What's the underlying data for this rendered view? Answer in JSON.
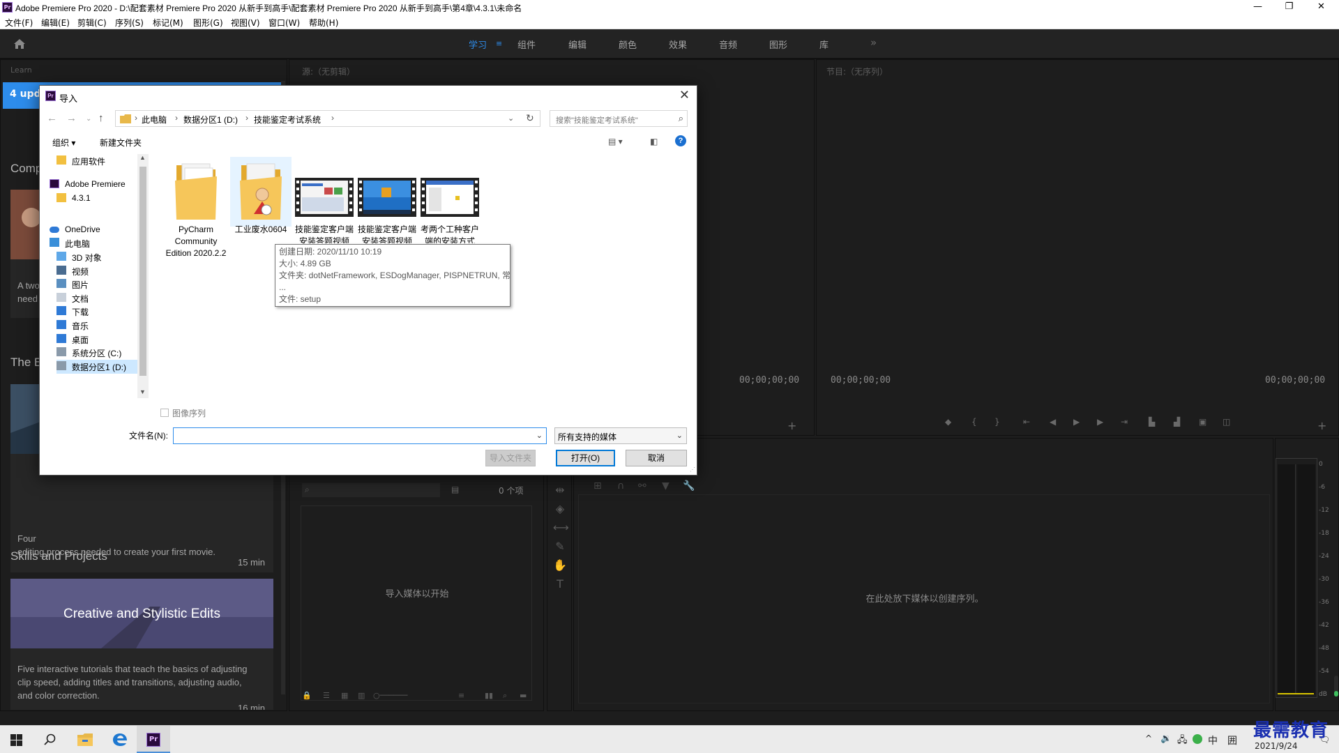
{
  "window": {
    "title": "Adobe Premiere Pro 2020 - D:\\配套素材 Premiere Pro 2020 从新手到高手\\配套素材 Premiere Pro 2020 从新手到高手\\第4章\\4.3.1\\未命名",
    "logo_text": "Pr"
  },
  "menu": [
    "文件(F)",
    "编辑(E)",
    "剪辑(C)",
    "序列(S)",
    "标记(M)",
    "图形(G)",
    "视图(V)",
    "窗口(W)",
    "帮助(H)"
  ],
  "workspaces": [
    "学习",
    "组件",
    "编辑",
    "颜色",
    "效果",
    "音频",
    "图形",
    "库"
  ],
  "workspace_active": "学习",
  "workspace_more": "»",
  "learn_panel": {
    "tab": "Learn",
    "updates_label": "4 upd",
    "section1": "Comp",
    "card1_desc": [
      "A two",
      "need"
    ],
    "section2": "The B",
    "card2_desc": [
      "Four",
      "editing process needed to create your first movie."
    ],
    "card2_duration": "15 min",
    "section3": "Skills and Projects",
    "card3_title": "Creative and Stylistic Edits",
    "card3_desc": [
      "Five interactive tutorials that teach the basics of adjusting",
      "clip speed, adding titles and transitions, adjusting audio,",
      "and color correction."
    ],
    "card3_duration": "16 min"
  },
  "source_panel": {
    "tab": "源:（无剪辑）",
    "timecode": "00;00;00;00"
  },
  "program_panel": {
    "tab": "节目:（无序列）",
    "timecode_left": "00;00;00;00",
    "timecode_right": "00;00;00;00"
  },
  "project_panel": {
    "count": "0 个项",
    "empty_text": "导入媒体以开始"
  },
  "timeline_panel": {
    "empty_text": "在此处放下媒体以创建序列。"
  },
  "audio_meter": {
    "ticks": [
      "0",
      "-6",
      "-12",
      "-18",
      "-24",
      "-30",
      "-36",
      "-42",
      "-48",
      "-54",
      "dB"
    ]
  },
  "dialog": {
    "title": "导入",
    "breadcrumb": [
      "此电脑",
      "数据分区1 (D:)",
      "技能鉴定考试系统"
    ],
    "search_placeholder": "搜索\"技能鉴定考试系统\"",
    "toolbar": {
      "organize": "组织 ▾",
      "new_folder": "新建文件夹"
    },
    "tree": [
      {
        "label": "应用软件",
        "icon": "folder-icon"
      },
      {
        "label": "Adobe Premiere",
        "icon": "premiere-icon"
      },
      {
        "label": "4.3.1",
        "icon": "folder-icon"
      },
      {
        "label": "OneDrive",
        "icon": "cloud-icon"
      },
      {
        "label": "此电脑",
        "icon": "computer-icon"
      },
      {
        "label": "3D 对象",
        "icon": "cube-icon"
      },
      {
        "label": "视频",
        "icon": "video-icon"
      },
      {
        "label": "图片",
        "icon": "picture-icon"
      },
      {
        "label": "文档",
        "icon": "document-icon"
      },
      {
        "label": "下载",
        "icon": "download-icon"
      },
      {
        "label": "音乐",
        "icon": "music-icon"
      },
      {
        "label": "桌面",
        "icon": "desktop-icon"
      },
      {
        "label": "系统分区 (C:)",
        "icon": "drive-icon"
      },
      {
        "label": "数据分区1 (D:)",
        "icon": "drive-icon"
      }
    ],
    "files": [
      {
        "label": "PyCharm Community Edition 2020.2.2",
        "kind": "folder"
      },
      {
        "label": "工业废水0604",
        "kind": "folder-user"
      },
      {
        "label": "技能鉴定客户端安装答题视频",
        "kind": "video"
      },
      {
        "label": "技能鉴定客户端安装答题视频",
        "kind": "video"
      },
      {
        "label": "考两个工种客户端的安装方式",
        "kind": "video"
      }
    ],
    "tooltip": [
      "创建日期: 2020/11/10 10:19",
      "大小: 4.89 GB",
      "文件夹: dotNetFramework, ESDogManager, PISPNETRUN, 常用插件,",
      "...",
      "文件: setup"
    ],
    "image_sequence_label": "图像序列",
    "filename_label": "文件名(N):",
    "filename_value": "",
    "filter_value": "所有支持的媒体",
    "buttons": {
      "import_folder": "导入文件夹",
      "open": "打开(O)",
      "cancel": "取消"
    }
  },
  "taskbar": {
    "tray": [
      "^",
      "🔊",
      "中",
      "囲"
    ],
    "date": "2021/9/24"
  },
  "watermark": "最需教育"
}
